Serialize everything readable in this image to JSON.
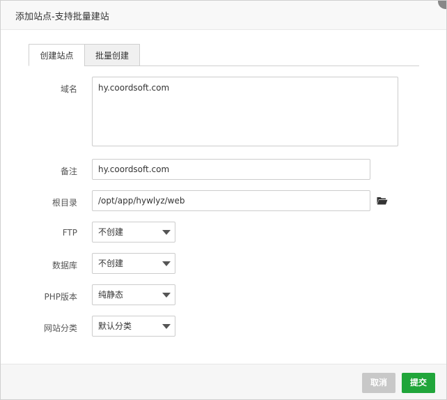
{
  "dialog": {
    "title": "添加站点-支持批量建站"
  },
  "tabs": [
    {
      "label": "创建站点",
      "active": true
    },
    {
      "label": "批量创建",
      "active": false
    }
  ],
  "form": {
    "domain_label": "域名",
    "domain_value": "hy.coordsoft.com",
    "remark_label": "备注",
    "remark_value": "hy.coordsoft.com",
    "root_label": "根目录",
    "root_value": "/opt/app/hywlyz/web",
    "ftp_label": "FTP",
    "ftp_value": "不创建",
    "db_label": "数据库",
    "db_value": "不创建",
    "php_label": "PHP版本",
    "php_value": "纯静态",
    "category_label": "网站分类",
    "category_value": "默认分类"
  },
  "footer": {
    "cancel_label": "取消",
    "submit_label": "提交"
  },
  "colors": {
    "primary": "#20a53a",
    "disabled": "#c8c8c8"
  },
  "icons": {
    "folder": "folder-open-icon",
    "caret": "caret-down-icon",
    "close": "close-icon"
  }
}
